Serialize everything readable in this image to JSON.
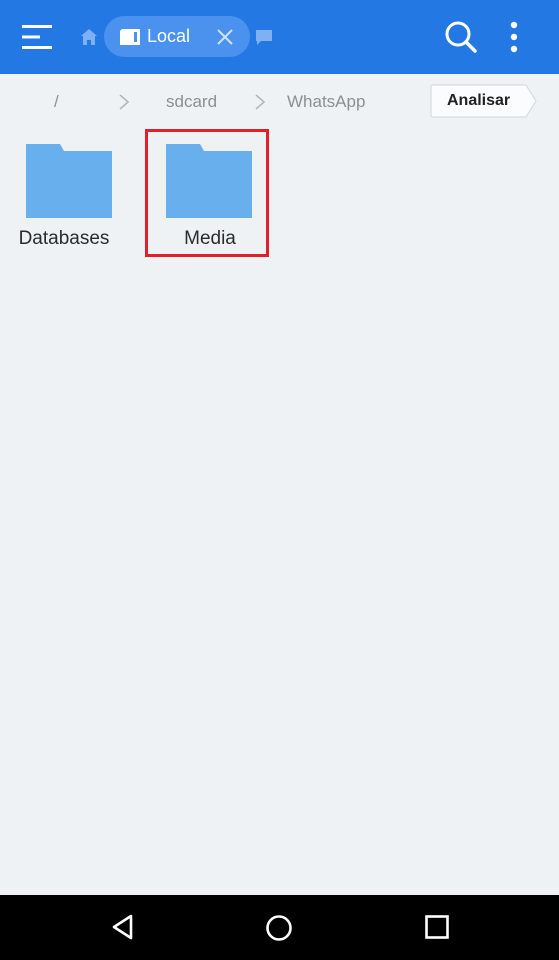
{
  "appbar": {
    "tab_label": "Local",
    "colors": {
      "bar": "#2478e4",
      "chip": "#4b92ee"
    },
    "icons": [
      "menu-icon",
      "home-icon",
      "sd-card-icon",
      "close-icon",
      "window-icon",
      "search-icon",
      "more-vertical-icon"
    ]
  },
  "breadcrumb": {
    "items": [
      "/",
      "sdcard",
      "WhatsApp"
    ],
    "analyze_label": "Analisar"
  },
  "folders": [
    {
      "label": "Databases",
      "highlighted": false
    },
    {
      "label": "Media",
      "highlighted": true
    }
  ],
  "highlight_color": "#e0202a",
  "navbar": {
    "icons": [
      "back-icon",
      "home-circle-icon",
      "recents-icon"
    ]
  }
}
